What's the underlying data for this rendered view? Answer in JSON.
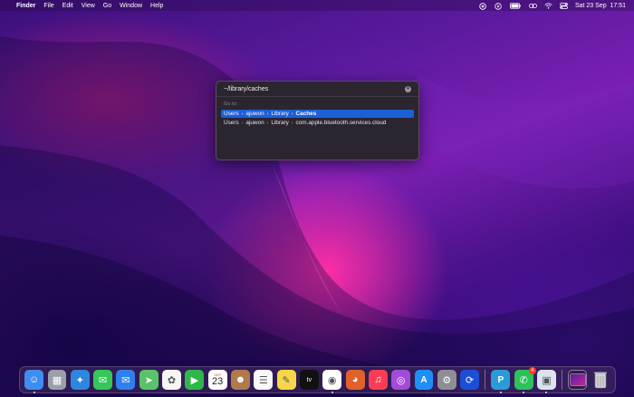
{
  "menubar": {
    "apple_symbol": "",
    "app_name": "Finder",
    "menus": [
      "File",
      "Edit",
      "View",
      "Go",
      "Window",
      "Help"
    ],
    "status_icons": [
      "screen-mirroring-icon",
      "play-circle-icon",
      "battery-icon",
      "link-icon",
      "wifi-icon",
      "control-center-icon"
    ],
    "datetime": "Sat 23 Sep  17:51"
  },
  "goto_dialog": {
    "input_value": "~/library/caches",
    "section_label": "Go to:",
    "rows": [
      {
        "crumbs": [
          "Users",
          "ajuwon",
          "Library",
          "Caches"
        ],
        "selected": true
      },
      {
        "crumbs": [
          "Users",
          "ajuwon",
          "Library",
          "com.apple.bluetooth.services.cloud"
        ],
        "selected": false
      }
    ]
  },
  "dock": {
    "calendar_month": "SEP",
    "calendar_day": "23",
    "whatsapp_badge": "4",
    "apps": [
      {
        "name": "finder",
        "bg": "#3d8ef0",
        "glyph": "☺",
        "running": true
      },
      {
        "name": "launchpad",
        "bg": "#9aa0aa",
        "glyph": "▦",
        "running": false
      },
      {
        "name": "safari",
        "bg": "#2e86de",
        "glyph": "✦",
        "running": false
      },
      {
        "name": "messages",
        "bg": "#34c759",
        "glyph": "✉",
        "running": false
      },
      {
        "name": "mail",
        "bg": "#2f80ed",
        "glyph": "✉",
        "running": false
      },
      {
        "name": "maps",
        "bg": "#5ac36a",
        "glyph": "➤",
        "running": false
      },
      {
        "name": "photos",
        "bg": "#f5f5f5",
        "glyph": "✿",
        "running": false
      },
      {
        "name": "facetime",
        "bg": "#2fb84a",
        "glyph": "▶",
        "running": false
      },
      {
        "name": "calendar",
        "bg": "#ffffff",
        "glyph": "",
        "running": false
      },
      {
        "name": "contacts",
        "bg": "#b07a4a",
        "glyph": "☻",
        "running": false
      },
      {
        "name": "reminders",
        "bg": "#f8f8f8",
        "glyph": "☰",
        "running": false
      },
      {
        "name": "notes",
        "bg": "#f7d64a",
        "glyph": "✎",
        "running": false
      },
      {
        "name": "apple-tv",
        "bg": "#111111",
        "glyph": "tv",
        "running": false
      },
      {
        "name": "chrome",
        "bg": "#ffffff",
        "glyph": "◉",
        "running": true
      },
      {
        "name": "firefox",
        "bg": "#e0622a",
        "glyph": "◕",
        "running": false
      },
      {
        "name": "music",
        "bg": "#fa3d55",
        "glyph": "♫",
        "running": false
      },
      {
        "name": "podcasts",
        "bg": "#a24bd8",
        "glyph": "◎",
        "running": false
      },
      {
        "name": "app-store",
        "bg": "#1e8ff5",
        "glyph": "A",
        "running": false
      },
      {
        "name": "system-settings",
        "bg": "#8e8e93",
        "glyph": "⚙",
        "running": false
      },
      {
        "name": "copilot",
        "bg": "#1d4ed8",
        "glyph": "⟳",
        "running": false
      },
      {
        "name": "pushbullet",
        "bg": "#2a9bd6",
        "glyph": "P",
        "running": true
      },
      {
        "name": "whatsapp",
        "bg": "#2cc25a",
        "glyph": "✆",
        "running": true
      },
      {
        "name": "preview",
        "bg": "#d9e4ef",
        "glyph": "▣",
        "running": true
      }
    ]
  },
  "colors": {
    "accent_selection": "#1d5fd6",
    "dialog_bg": "#2b2530"
  }
}
